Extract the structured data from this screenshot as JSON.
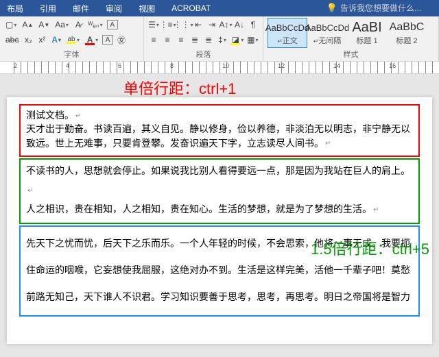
{
  "tabs": {
    "layout": "布局",
    "references": "引用",
    "mailings": "邮件",
    "review": "审阅",
    "view": "视图",
    "acrobat": "ACROBAT",
    "tellme_placeholder": "告诉我您想要做什么..."
  },
  "groups": {
    "font": "字体",
    "paragraph": "段落",
    "styles": "样式"
  },
  "styles": {
    "normal_prev": "AaBbCcDd",
    "normal_name": "正文",
    "nospace_prev": "AaBbCcDd",
    "nospace_name": "无间隔",
    "h1_prev": "AaBI",
    "h1_name": "标题 1",
    "h2_prev": "AaBbC",
    "h2_name": "标题 2"
  },
  "ruler": {
    "n2": "2",
    "n4": "4",
    "n6": "6",
    "n8": "8",
    "n10": "10",
    "n12": "12",
    "n14": "14",
    "n16": "16"
  },
  "anno": {
    "single": "单倍行距：ctrl+1",
    "onehalf": "1.5倍行距：ctrl+5"
  },
  "doc": {
    "box1_l1": "测试文档。",
    "box1_l2": "天才出于勤奋。书读百遍，其义自见。静以修身，俭以养德，非淡泊无以明志，非宁静无以致远。世上无难事，只要肯登攀。发奋识遍天下字，立志读尽人间书。",
    "box2_l1": "不读书的人，思想就会停止。如果说我比别人看得要远一点，那是因为我站在巨人的肩上。",
    "box2_l2": "人之相识，贵在相知，人之相知，贵在知心。生活的梦想，就是为了梦想的生活。",
    "box3": "先天下之忧而忧，后天下之乐而乐。一个人年轻的时候，不会思索，他将一事无成。我要扼住命运的咽喉，它妄想使我屈服，这绝对办不到。生活是这样完美，活他一千辈子吧！莫愁前路无知己，天下谁人不识君。学习知识要善于思考，思考，再思考。明日之帝国将是智力"
  }
}
